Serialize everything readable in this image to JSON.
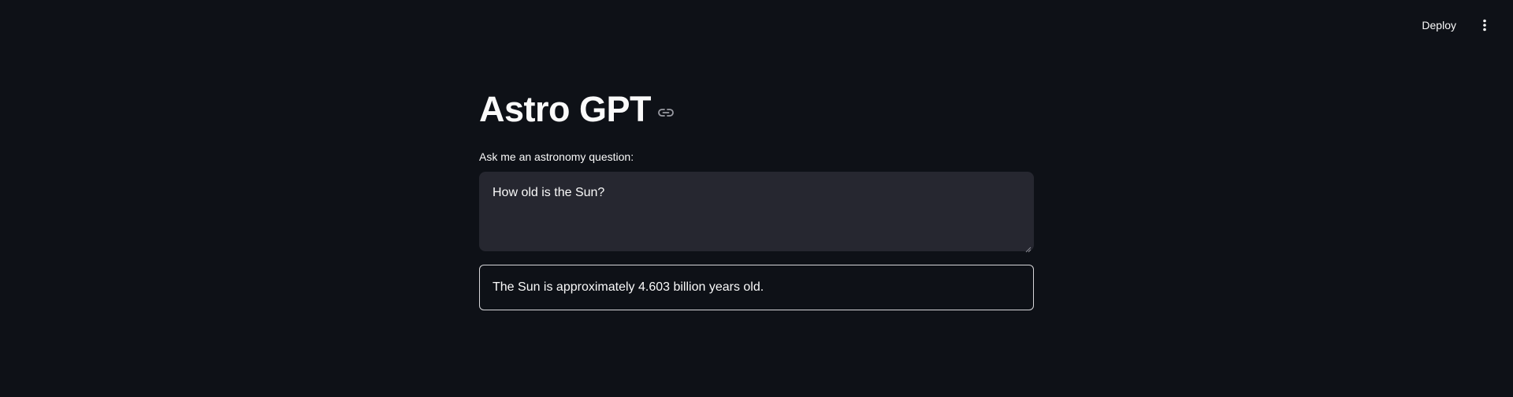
{
  "toolbar": {
    "deploy_label": "Deploy",
    "menu_icon": "more-vertical-icon"
  },
  "main": {
    "title": "Astro GPT",
    "title_link_icon": "link-icon",
    "question_label": "Ask me an astronomy question:",
    "question_value": "How old is the Sun?",
    "answer_text": "The Sun is approximately 4.603 billion years old."
  },
  "colors": {
    "background": "#0e1117",
    "input_background": "#262730",
    "text": "#fafafa",
    "border": "#d6d6d9"
  }
}
